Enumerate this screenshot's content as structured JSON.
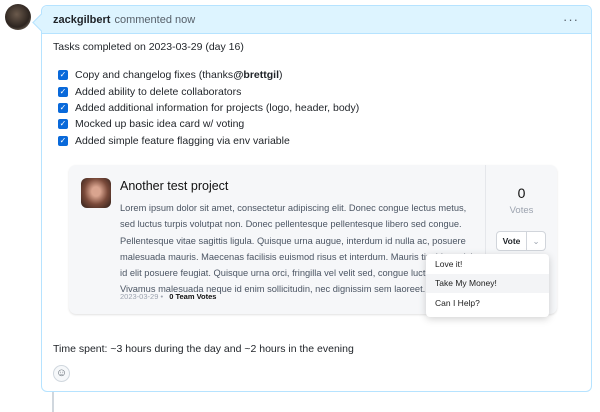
{
  "comment": {
    "author": "zackgilbert",
    "meta": "commented now",
    "menu_icon": "kebab-icon",
    "intro": "Tasks completed on 2023-03-29 (day 16)",
    "tasks": [
      {
        "text": "Copy and changelog fixes (thanks ",
        "mention": "@brettgil",
        "after": ")",
        "checked": true
      },
      {
        "text": "Added ability to delete collaborators",
        "checked": true
      },
      {
        "text": "Added additional information for projects (logo, header, body)",
        "checked": true
      },
      {
        "text": "Mocked up basic idea card w/ voting",
        "checked": true
      },
      {
        "text": "Added simple feature flagging via env variable",
        "checked": true
      }
    ],
    "time_spent": "Time spent: ~3 hours during the day and ~2 hours in the evening"
  },
  "card": {
    "title": "Another test project",
    "body": "Lorem ipsum dolor sit amet, consectetur adipiscing elit. Donec congue lectus metus, sed luctus turpis volutpat non. Donec pellentesque pellentesque libero sed congue. Pellentesque vitae sagittis ligula. Quisque urna augue, interdum id nulla ac, posuere malesuada mauris. Maecenas facilisis euismod risus et interdum. Mauris tincidunt nisi id elit posuere feugiat. Quisque urna orci, fringilla vel velit sed, congue luctus purus. Vivamus malesuada neque id enim sollicitudin, nec dignissim sem laoreet.",
    "date": "2023-03-29",
    "sep": "•",
    "team_votes": "0 Team Votes",
    "votes": "0",
    "votes_label": "Votes",
    "vote_button": "Vote",
    "menu": [
      "Love it!",
      "Take My Money!",
      "Can I Help?"
    ]
  }
}
